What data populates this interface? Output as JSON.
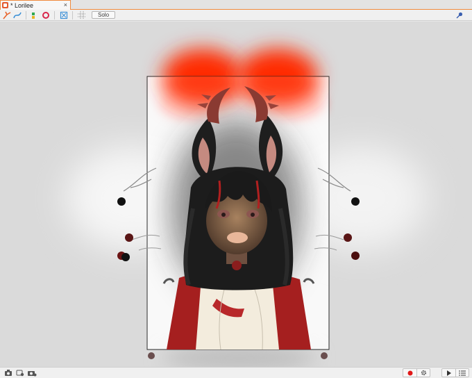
{
  "document_tab": {
    "title": "* Lorilee",
    "close_glyph": "×",
    "icon": "app-document-icon"
  },
  "toolbar": {
    "solo_label": "Solo",
    "icons": [
      "deform-tool-icon",
      "curve-tool-icon",
      "parameters-icon",
      "record-icon",
      "fit-view-icon",
      "grid-icon",
      "pin-icon"
    ]
  },
  "statusbar": {
    "icons": [
      "camera-icon",
      "camera-settings-icon",
      "camera-multi-icon",
      "record-icon",
      "settings-icon",
      "play-icon",
      "list-icon"
    ]
  },
  "colors": {
    "accent_orange": "#f08a3c",
    "record_red": "#e01818",
    "hair_black": "#1c1c1c",
    "jacket_red": "#a51f1f",
    "glow_red": "#ff2200"
  }
}
